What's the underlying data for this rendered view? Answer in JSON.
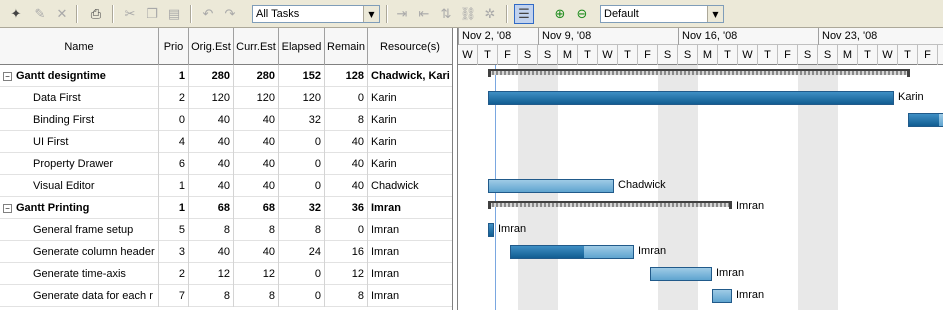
{
  "toolbar": {
    "filter_value": "All Tasks",
    "profile_value": "Default"
  },
  "grid": {
    "columns": [
      "Name",
      "Prio",
      "Orig.Est",
      "Curr.Est",
      "Elapsed",
      "Remain",
      "Resource(s)"
    ],
    "rows": [
      {
        "name": "Gantt designtime",
        "prio": "1",
        "orig": "280",
        "curr": "280",
        "elapsed": "152",
        "remain": "128",
        "res": "Chadwick, Kari",
        "summary": true,
        "toggle": "−"
      },
      {
        "name": "Data First",
        "prio": "2",
        "orig": "120",
        "curr": "120",
        "elapsed": "120",
        "remain": "0",
        "res": "Karin"
      },
      {
        "name": "Binding First",
        "prio": "0",
        "orig": "40",
        "curr": "40",
        "elapsed": "32",
        "remain": "8",
        "res": "Karin"
      },
      {
        "name": "UI First",
        "prio": "4",
        "orig": "40",
        "curr": "40",
        "elapsed": "0",
        "remain": "40",
        "res": "Karin"
      },
      {
        "name": "Property Drawer",
        "prio": "6",
        "orig": "40",
        "curr": "40",
        "elapsed": "0",
        "remain": "40",
        "res": "Karin"
      },
      {
        "name": "Visual Editor",
        "prio": "1",
        "orig": "40",
        "curr": "40",
        "elapsed": "0",
        "remain": "40",
        "res": "Chadwick"
      },
      {
        "name": "Gantt Printing",
        "prio": "1",
        "orig": "68",
        "curr": "68",
        "elapsed": "32",
        "remain": "36",
        "res": "Imran",
        "summary": true,
        "toggle": "−"
      },
      {
        "name": "General frame setup",
        "prio": "5",
        "orig": "8",
        "curr": "8",
        "elapsed": "8",
        "remain": "0",
        "res": "Imran"
      },
      {
        "name": "Generate column header",
        "prio": "3",
        "orig": "40",
        "curr": "40",
        "elapsed": "24",
        "remain": "16",
        "res": "Imran"
      },
      {
        "name": "Generate time-axis",
        "prio": "2",
        "orig": "12",
        "curr": "12",
        "elapsed": "0",
        "remain": "12",
        "res": "Imran"
      },
      {
        "name": "Generate data for each r",
        "prio": "7",
        "orig": "8",
        "curr": "8",
        "elapsed": "0",
        "remain": "8",
        "res": "Imran"
      }
    ]
  },
  "timeline": {
    "weeks": [
      "Nov 2, '08",
      "Nov 9, '08",
      "Nov 16, '08",
      "Nov 23, '08"
    ],
    "days": [
      "W",
      "T",
      "F",
      "S",
      "S",
      "M",
      "T",
      "W",
      "T",
      "F",
      "S",
      "S",
      "M",
      "T",
      "W",
      "T",
      "F",
      "S",
      "S",
      "M",
      "T",
      "W",
      "T",
      "F"
    ]
  },
  "bars": [
    {
      "row": 0,
      "type": "summary",
      "startDay": 1.5,
      "endDay": 22.6,
      "label": ""
    },
    {
      "row": 1,
      "type": "task",
      "startDay": 1.5,
      "endDay": 21.8,
      "progress": 1.0,
      "label": "Karin"
    },
    {
      "row": 2,
      "type": "task",
      "startDay": 22.5,
      "endDay": 24.5,
      "progress": 0.8,
      "label": ""
    },
    {
      "row": 5,
      "type": "task",
      "startDay": 1.5,
      "endDay": 7.8,
      "progress": 0,
      "label": "Chadwick"
    },
    {
      "row": 6,
      "type": "summary",
      "startDay": 1.5,
      "endDay": 13.7,
      "label": "Imran"
    },
    {
      "row": 7,
      "type": "task",
      "startDay": 1.5,
      "endDay": 1.8,
      "progress": 1.0,
      "label": "Imran"
    },
    {
      "row": 8,
      "type": "task",
      "startDay": 2.6,
      "endDay": 8.8,
      "progress": 0.6,
      "label": "Imran"
    },
    {
      "row": 9,
      "type": "task",
      "startDay": 9.6,
      "endDay": 12.7,
      "progress": 0,
      "label": "Imran"
    },
    {
      "row": 10,
      "type": "task",
      "startDay": 12.7,
      "endDay": 13.7,
      "progress": 0,
      "label": "Imran"
    }
  ]
}
